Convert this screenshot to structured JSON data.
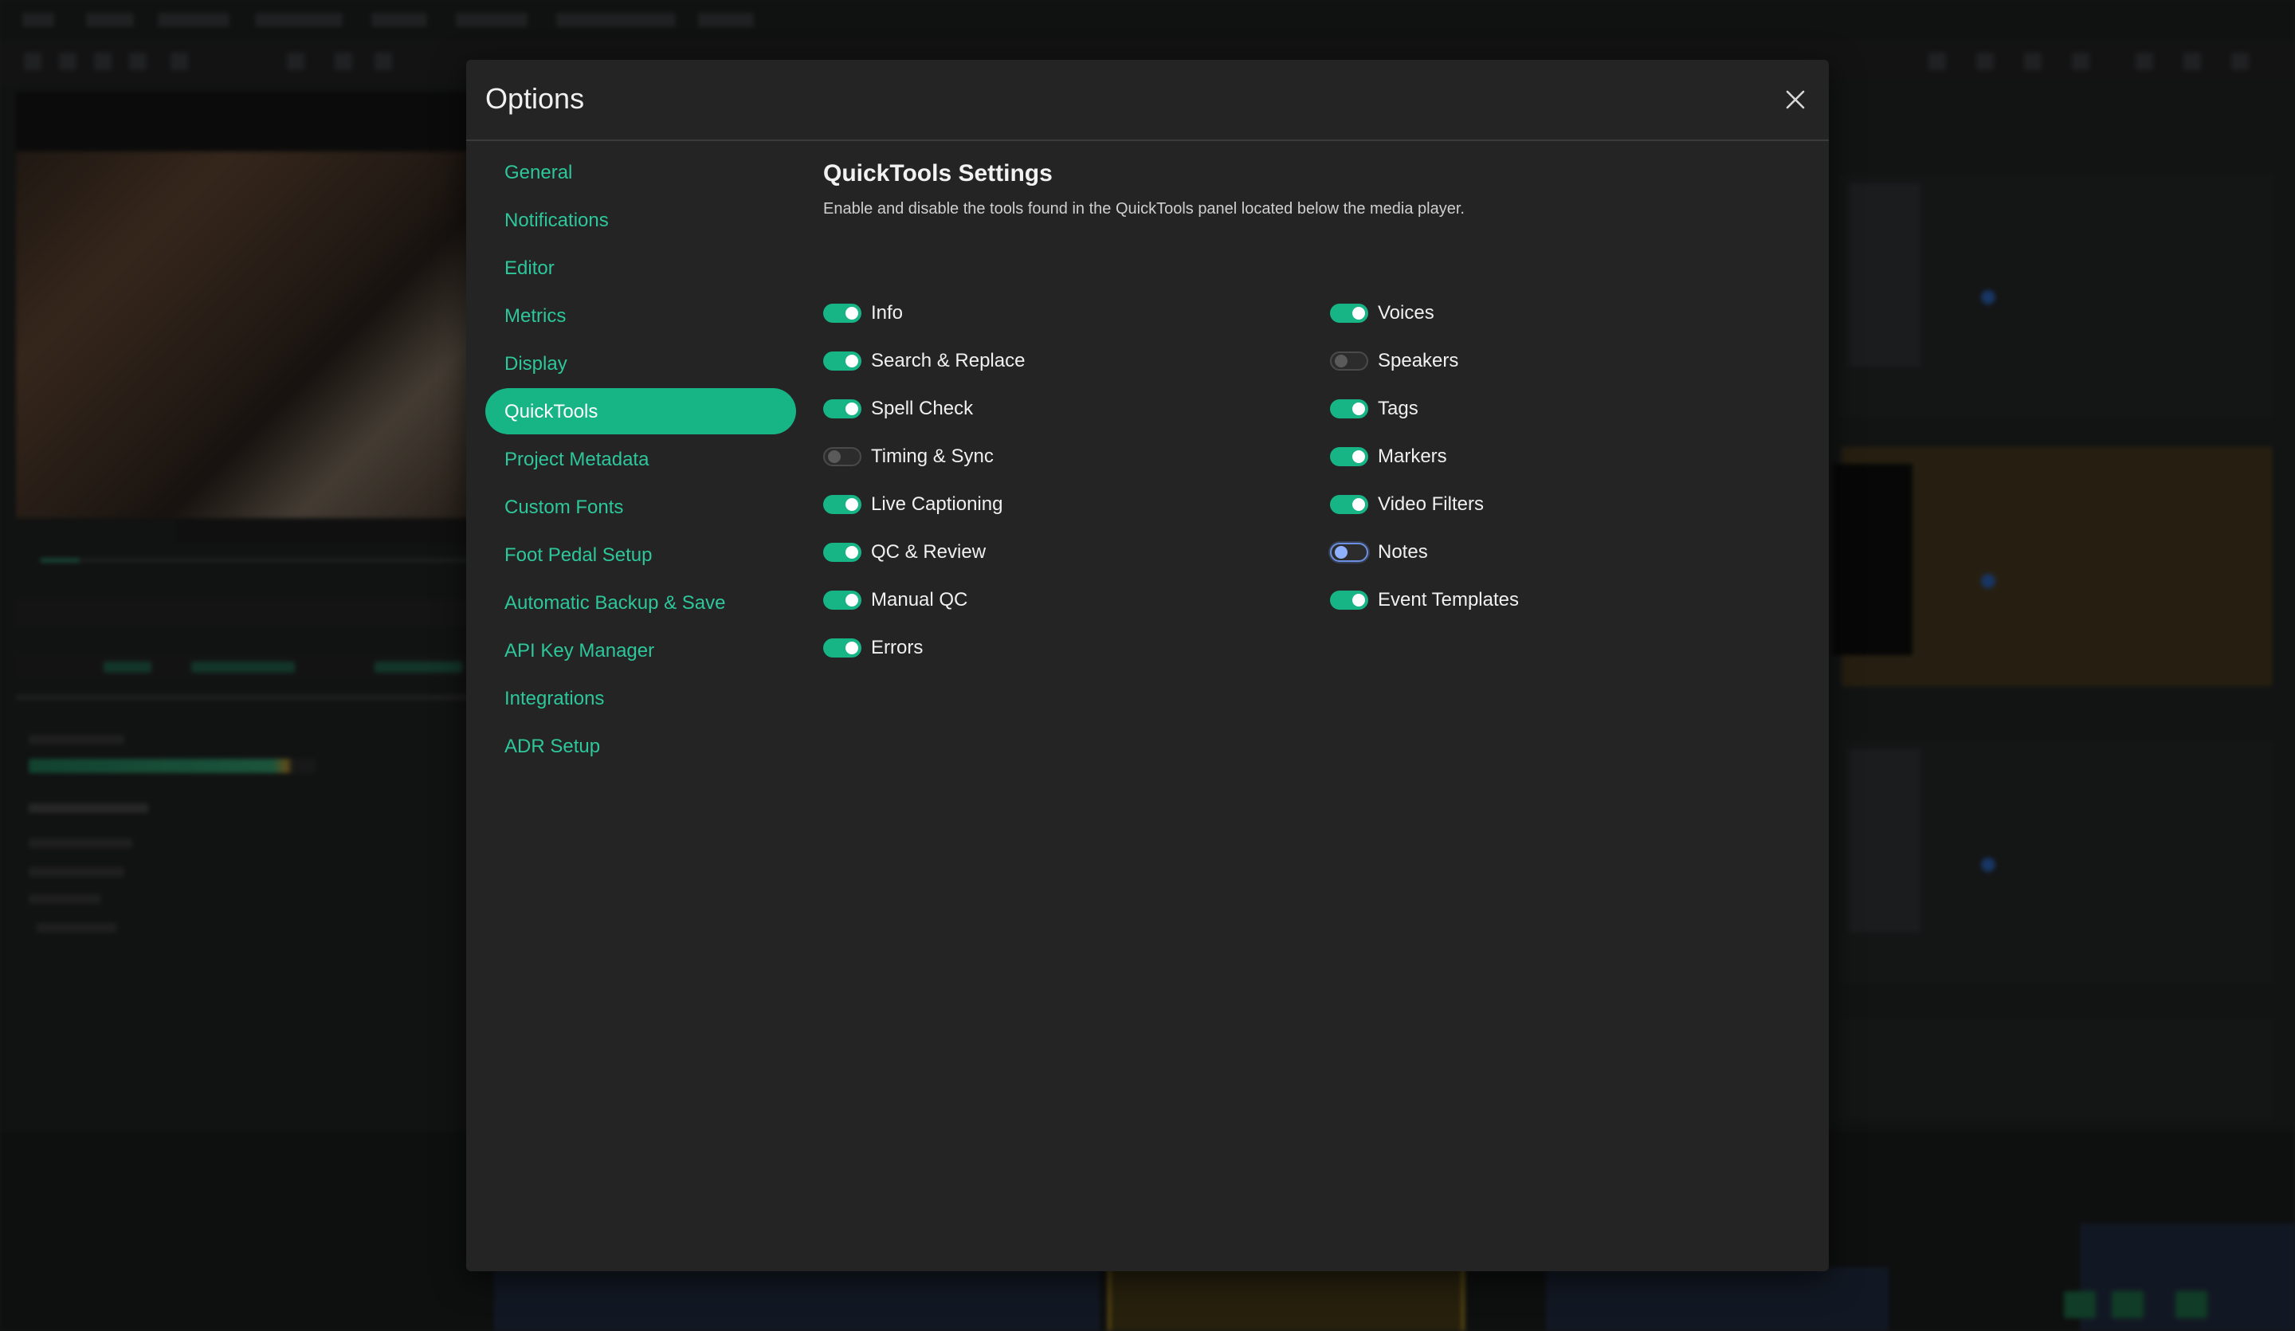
{
  "modal": {
    "title": "Options",
    "close_icon": "close-icon"
  },
  "sidebar": {
    "active": "QuickTools",
    "items": [
      {
        "label": "General"
      },
      {
        "label": "Notifications"
      },
      {
        "label": "Editor"
      },
      {
        "label": "Metrics"
      },
      {
        "label": "Display"
      },
      {
        "label": "QuickTools"
      },
      {
        "label": "Project Metadata"
      },
      {
        "label": "Custom Fonts"
      },
      {
        "label": "Foot Pedal Setup"
      },
      {
        "label": "Automatic Backup & Save"
      },
      {
        "label": "API Key Manager"
      },
      {
        "label": "Integrations"
      },
      {
        "label": "ADR Setup"
      }
    ]
  },
  "content": {
    "title": "QuickTools Settings",
    "description": "Enable and disable the tools found in the QuickTools panel located below the media player.",
    "left_tools": [
      {
        "label": "Info",
        "enabled": true
      },
      {
        "label": "Search & Replace",
        "enabled": true
      },
      {
        "label": "Spell Check",
        "enabled": true
      },
      {
        "label": "Timing & Sync",
        "enabled": false
      },
      {
        "label": "Live Captioning",
        "enabled": true
      },
      {
        "label": "QC & Review",
        "enabled": true
      },
      {
        "label": "Manual QC",
        "enabled": true
      },
      {
        "label": "Errors",
        "enabled": true
      }
    ],
    "right_tools": [
      {
        "label": "Voices",
        "enabled": true
      },
      {
        "label": "Speakers",
        "enabled": false
      },
      {
        "label": "Tags",
        "enabled": true
      },
      {
        "label": "Markers",
        "enabled": true
      },
      {
        "label": "Video Filters",
        "enabled": true
      },
      {
        "label": "Notes",
        "enabled": false,
        "focused": true
      },
      {
        "label": "Event Templates",
        "enabled": true
      }
    ]
  },
  "colors": {
    "accent": "#17b486",
    "link": "#2dc79a",
    "modal_bg": "#242424",
    "focus_ring": "#6b8fe0"
  }
}
